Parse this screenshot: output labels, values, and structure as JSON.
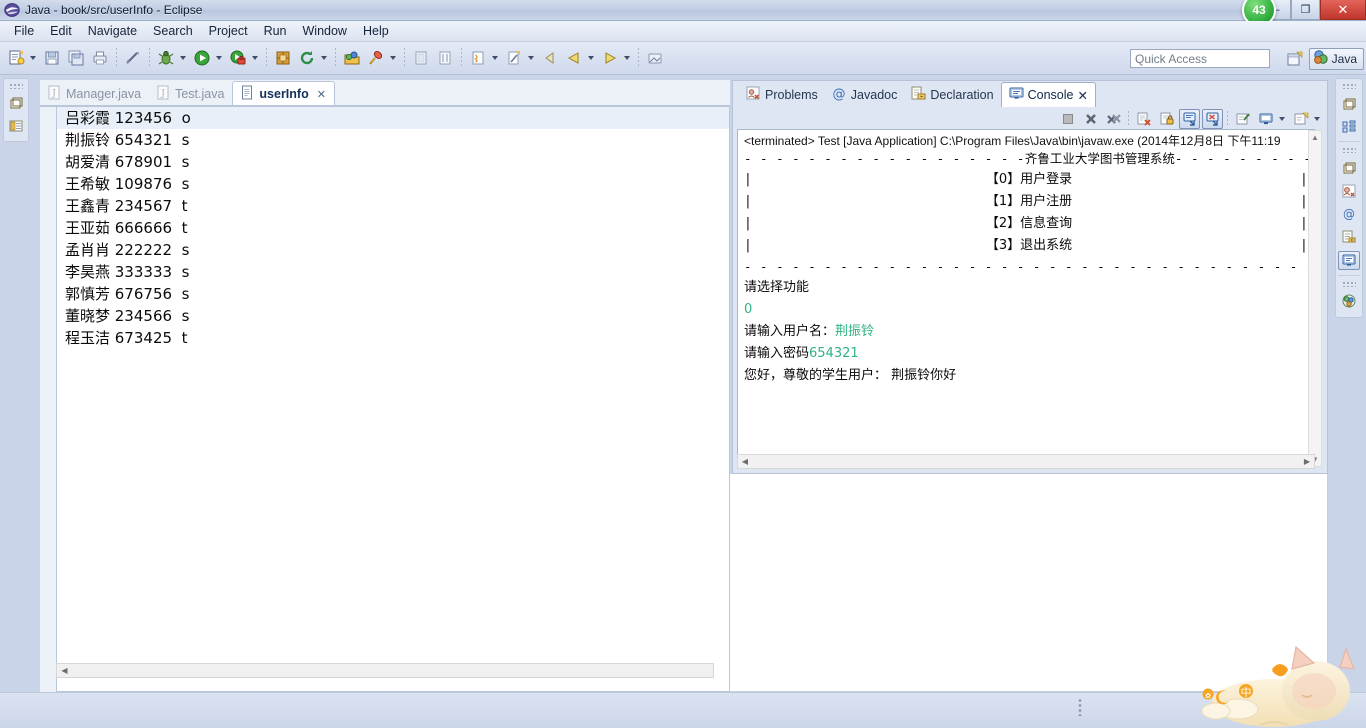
{
  "window": {
    "title": "Java - book/src/userInfo - Eclipse",
    "app_icon": "eclipse-icon",
    "badge": "43",
    "minimize": "–",
    "restore": "❐",
    "close": "✕"
  },
  "menubar": {
    "items": [
      {
        "label": "File",
        "accel": "F"
      },
      {
        "label": "Edit",
        "accel": "E"
      },
      {
        "label": "Navigate",
        "accel": "N"
      },
      {
        "label": "Search",
        "accel": "a"
      },
      {
        "label": "Project",
        "accel": "P"
      },
      {
        "label": "Run",
        "accel": "R"
      },
      {
        "label": "Window",
        "accel": "W"
      },
      {
        "label": "Help",
        "accel": "H"
      }
    ]
  },
  "toolbar": {
    "icons": [
      "new-wizard-icon",
      "save-icon",
      "save-all-icon",
      "print-icon",
      "toggle-mark-occurrences-icon",
      "debug-icon",
      "run-icon",
      "external-tools-icon",
      "new-java-package-icon",
      "refresh-icon",
      "open-type-icon",
      "search-icon",
      "previous-annotation-icon",
      "next-annotation-icon",
      "toggle-breadcrumb-icon",
      "last-edit-location-icon",
      "back-icon",
      "forward-icon",
      "pin-editor-icon"
    ],
    "quick_access_placeholder": "Quick Access",
    "open_perspective_icon": "open-perspective-icon",
    "perspective_label": "Java",
    "perspective_icon": "java-perspective-icon"
  },
  "fastview_left": {
    "icons": [
      "restore-icon",
      "package-explorer-icon"
    ]
  },
  "fastview_right": {
    "groups": [
      {
        "icons": [
          "restore-icon",
          "outline-icon"
        ]
      },
      {
        "icons": [
          "restore-icon",
          "problems-icon",
          "javadoc-icon",
          "declaration-icon",
          "console-icon"
        ]
      },
      {
        "icons": [
          "restore-icon",
          "hierarchy-icon"
        ]
      }
    ]
  },
  "editor": {
    "tabs": [
      {
        "label": "Manager.java",
        "icon": "java-file-icon",
        "active": false,
        "closable": false
      },
      {
        "label": "Test.java",
        "icon": "java-file-icon",
        "active": false,
        "closable": false
      },
      {
        "label": "userInfo",
        "icon": "text-file-icon",
        "active": true,
        "closable": true
      }
    ],
    "close_glyph": "✕",
    "lines": [
      {
        "text": "吕彩霞 123456  o",
        "current": true
      },
      {
        "text": "荆振铃 654321  s",
        "current": false
      },
      {
        "text": "胡爱清 678901  s",
        "current": false
      },
      {
        "text": "王希敏 109876  s",
        "current": false
      },
      {
        "text": "王鑫青 234567  t",
        "current": false
      },
      {
        "text": "王亚茹 666666  t",
        "current": false
      },
      {
        "text": "孟肖肖 222222  s",
        "current": false
      },
      {
        "text": "李昊燕 333333  s",
        "current": false
      },
      {
        "text": "郭慎芳 676756  s",
        "current": false
      },
      {
        "text": "董晓梦 234566  s",
        "current": false
      },
      {
        "text": "程玉洁 673425  t",
        "current": false
      }
    ],
    "hscroll_left_glyph": "◀",
    "hscroll_right_glyph": "▶"
  },
  "console_view": {
    "tabs": [
      {
        "label": "Problems",
        "icon": "problems-icon",
        "active": false,
        "closable": false
      },
      {
        "label": "Javadoc",
        "icon": "javadoc-at-icon",
        "active": false,
        "closable": false
      },
      {
        "label": "Declaration",
        "icon": "declaration-icon",
        "active": false,
        "closable": false
      },
      {
        "label": "Console",
        "icon": "console-icon",
        "active": true,
        "closable": true
      }
    ],
    "close_glyph": "✕",
    "toolbar_icons": [
      "terminate-icon",
      "remove-launch-icon",
      "remove-all-terminated-icon",
      "clear-console-icon",
      "scroll-lock-icon",
      "show-console-on-output-icon",
      "show-console-on-error-icon",
      "pin-console-icon",
      "display-selected-console-icon",
      "display-selected-console-menu-icon",
      "open-console-icon",
      "open-console-menu-icon"
    ],
    "header": "<terminated> Test [Java Application] C:\\Program Files\\Java\\bin\\javaw.exe (2014年12月8日 下午11:19",
    "output": {
      "top_border_left": "- - - - - - - - - - - - - - - - - -",
      "banner_title": "齐鲁工业大学图书管理系统",
      "top_border_right": "- - - - - - - - - - - - - -",
      "menu_items": [
        "【0】用户登录",
        "【1】用户注册",
        "【2】信息查询",
        "【3】退出系统"
      ],
      "side_bar": "|",
      "bottom_border": "- - - - - - - - - - - - - - - - - - - - - - - - - - - - - - - - - - - - - - - - - - - - - -",
      "prompt_select": "请选择功能",
      "input_choice": "0",
      "prompt_username": "请输入用户名：",
      "input_username": "荆振铃",
      "prompt_password": "请输入密码",
      "input_password": "654321",
      "greeting": "您好，尊敬的学生用户： 荆振铃你好"
    },
    "vscroll_up_glyph": "▲",
    "vscroll_down_glyph": "▼",
    "hscroll_left_glyph": "◀",
    "hscroll_right_glyph": "▶"
  },
  "status": {
    "grip": "resize-grip",
    "ime_mascot": "sleeping-cat-ime-icon"
  },
  "colors": {
    "console_input_green": "#2fb380",
    "title_bar_blue": "#c2cee4",
    "accent_blue": "#7f93b5",
    "close_red": "#c0362c",
    "badge_green": "#29a83a"
  }
}
